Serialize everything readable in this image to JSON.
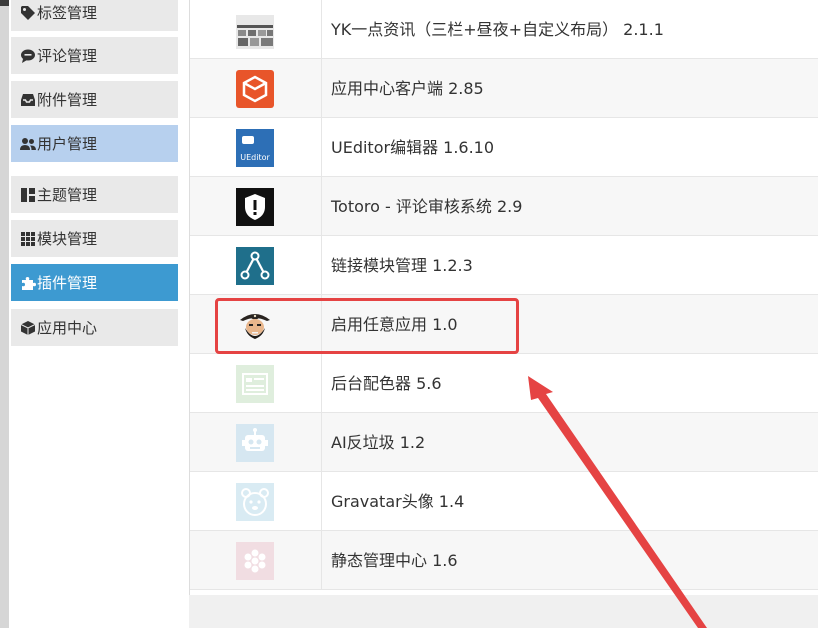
{
  "sidebar": {
    "items": [
      {
        "label": "标签管理",
        "icon": "tag-icon"
      },
      {
        "label": "评论管理",
        "icon": "comment-icon"
      },
      {
        "label": "附件管理",
        "icon": "inbox-icon"
      },
      {
        "label": "用户管理",
        "icon": "users-icon"
      },
      {
        "label": "主题管理",
        "icon": "layout-icon"
      },
      {
        "label": "模块管理",
        "icon": "grid-icon"
      },
      {
        "label": "插件管理",
        "icon": "puzzle-icon"
      },
      {
        "label": "应用中心",
        "icon": "cube-icon"
      }
    ]
  },
  "plugins": [
    {
      "name": "YK一点资讯（三栏+昼夜+自定义布局） 2.1.1",
      "icon": "screenshot-thumbnail-icon"
    },
    {
      "name": "应用中心客户端 2.85",
      "icon": "app-center-box-icon"
    },
    {
      "name": "UEditor编辑器 1.6.10",
      "icon": "ueditor-icon",
      "icon_text": "UEditor"
    },
    {
      "name": "Totoro - 评论审核系统 2.9",
      "icon": "shield-exclamation-icon"
    },
    {
      "name": "链接模块管理 1.2.3",
      "icon": "link-nodes-icon"
    },
    {
      "name": "启用任意应用 1.0",
      "icon": "pirate-avatar-icon"
    },
    {
      "name": "后台配色器 5.6",
      "icon": "color-panel-icon"
    },
    {
      "name": "AI反垃圾 1.2",
      "icon": "robot-icon"
    },
    {
      "name": "Gravatar头像 1.4",
      "icon": "bear-face-icon"
    },
    {
      "name": "静态管理中心 1.6",
      "icon": "flower-icon"
    }
  ],
  "colors": {
    "active_user": "#b7d0ee",
    "active_plugin": "#3d9ad1",
    "annotation_red": "#e54343"
  }
}
